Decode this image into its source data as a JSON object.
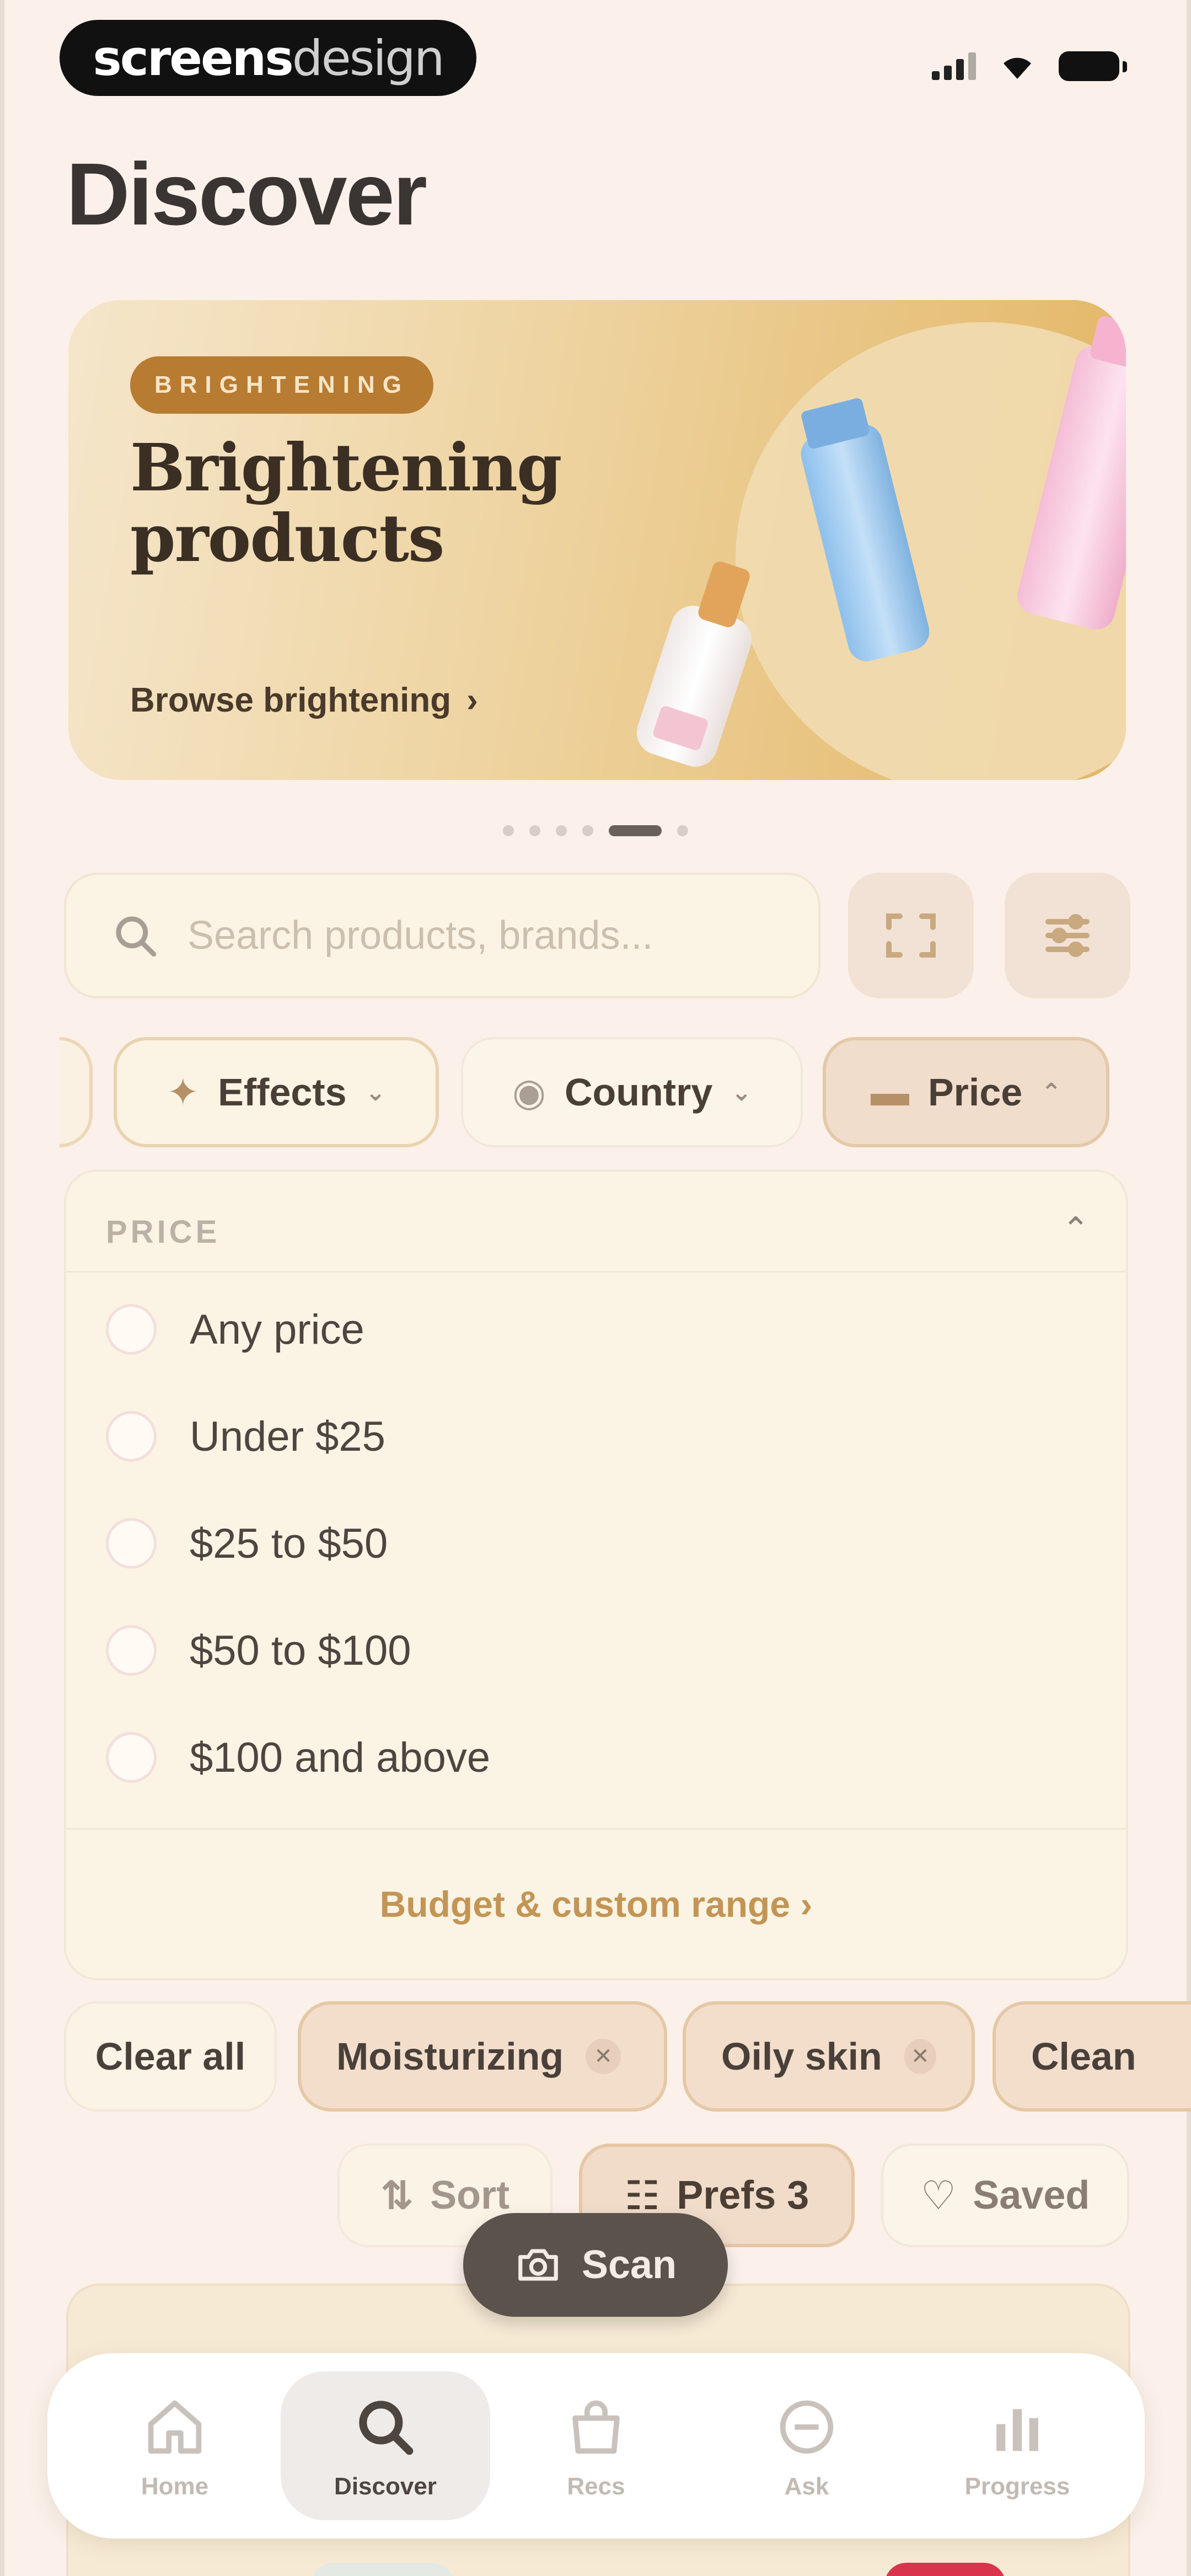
{
  "status_bar": {
    "brand_bold": "screens",
    "brand_light": "design"
  },
  "page": {
    "title": "Discover"
  },
  "hero": {
    "badge": "BRIGHTENING",
    "title": "Brightening products",
    "link": "Browse brightening",
    "carousel_pages": 6,
    "carousel_active": 5
  },
  "search": {
    "placeholder": "Search products, brands..."
  },
  "filter_chips": [
    {
      "label": "Effects",
      "icon": "sparkle-icon",
      "expanded": false
    },
    {
      "label": "Country",
      "icon": "globe-icon",
      "expanded": false
    },
    {
      "label": "Price",
      "icon": "wallet-icon",
      "expanded": true
    }
  ],
  "price_panel": {
    "heading": "PRICE",
    "options": [
      "Any price",
      "Under $25",
      "$25 to $50",
      "$50 to $100",
      "$100 and above"
    ],
    "budget_link": "Budget & custom range"
  },
  "active_tags": {
    "clear_label": "Clear all",
    "items": [
      "Moisturizing",
      "Oily skin",
      "Clean"
    ]
  },
  "actions": {
    "sort": "Sort",
    "prefs": "Prefs 3",
    "saved": "Saved"
  },
  "scan_button": "Scan",
  "bottom_nav": [
    {
      "label": "Home",
      "icon": "home-icon",
      "active": false
    },
    {
      "label": "Discover",
      "icon": "search-icon",
      "active": true
    },
    {
      "label": "Recs",
      "icon": "bag-icon",
      "active": false
    },
    {
      "label": "Ask",
      "icon": "chat-icon",
      "active": false
    },
    {
      "label": "Progress",
      "icon": "bar-chart-icon",
      "active": false
    }
  ],
  "colors": {
    "background": "#fbf1ea",
    "accent_gold": "#c39555",
    "badge_brown": "#b77b31",
    "chip_active": "#f1ddcc",
    "scan_pill": "#5a524b"
  }
}
